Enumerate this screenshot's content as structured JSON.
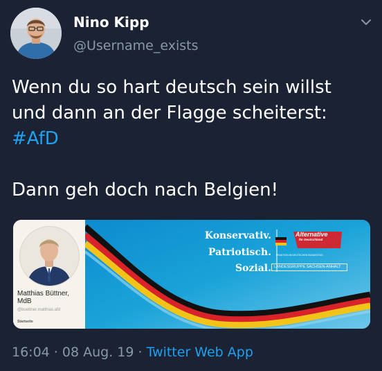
{
  "tweet": {
    "display_name": "Nino Kipp",
    "username": "@Username_exists",
    "text_line1": "Wenn du so hart deutsch sein willst",
    "text_line2": "und dann an der Flagge scheiterst:",
    "hashtag": "#AfD",
    "text_line4": "Dann geh doch nach Belgien!",
    "timestamp": "16:04 · 08 Aug. 19 · ",
    "source_app": "Twitter Web App"
  },
  "card": {
    "profile_name": "Matthias Büttner, MdB",
    "profile_handle": "@buettner.matthias.afd",
    "profile_link": "Startseite",
    "slogans": [
      "Konservativ.",
      "Patriotisch.",
      "Sozial."
    ],
    "party_name": "Alternative",
    "party_sub": "für Deutschland",
    "fraktion_text": "FRAKTION IM DEUTSCHEN BUNDESTAG",
    "group_label": "LANDESGRUPPE SACHSEN-ANHALT"
  },
  "icons": {
    "menu": "chevron-down-icon"
  },
  "colors": {
    "background": "#1b2233",
    "link": "#1da1f2",
    "muted": "#8899a6",
    "banner_blue": "#1aa3d8"
  }
}
